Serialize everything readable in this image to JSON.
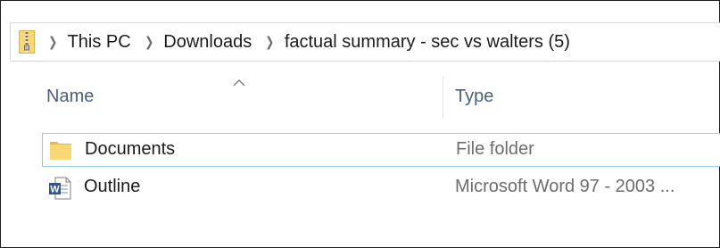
{
  "breadcrumb": {
    "items": [
      "This PC",
      "Downloads",
      "factual summary - sec vs walters (5)"
    ]
  },
  "columns": {
    "name": "Name",
    "type": "Type"
  },
  "files": [
    {
      "name": "Documents",
      "type": "File folder",
      "icon": "folder-icon"
    },
    {
      "name": "Outline",
      "type": "Microsoft Word 97 - 2003 ...",
      "icon": "word-doc-icon"
    }
  ],
  "colors": {
    "folder": "#f8d775",
    "word_blue": "#2b579a",
    "selection_border": "#99c9ef",
    "header_text": "#4c607a",
    "secondary_text": "#6d6d6d"
  }
}
